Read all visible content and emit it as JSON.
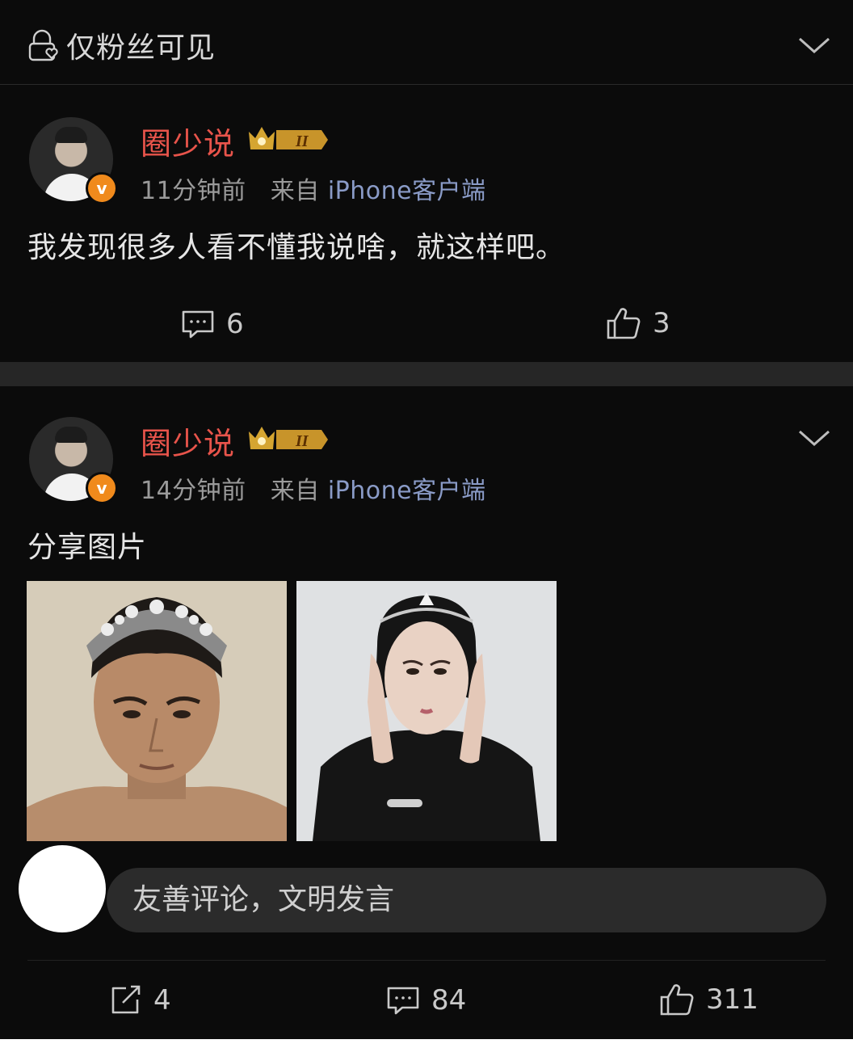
{
  "visibility": {
    "label": "仅粉丝可见"
  },
  "posts": [
    {
      "author": "圈少说",
      "rank_badge": "II",
      "time": "11分钟前",
      "source_prefix": "来自",
      "source": "iPhone客户端",
      "text": "我发现很多人看不懂我说啥，就这样吧。",
      "comments": "6",
      "likes": "3"
    },
    {
      "author": "圈少说",
      "rank_badge": "II",
      "time": "14分钟前",
      "source_prefix": "来自",
      "source": "iPhone客户端",
      "text": "分享图片",
      "images": [
        "male-portrait-tiara-photo",
        "female-portrait-tiara-photo"
      ],
      "comment_placeholder": "友善评论，文明发言",
      "reposts": "4",
      "comments": "84",
      "likes": "311"
    }
  ],
  "colors": {
    "username": "#e8544b",
    "background": "#000000",
    "verified": "#f08a1c"
  }
}
